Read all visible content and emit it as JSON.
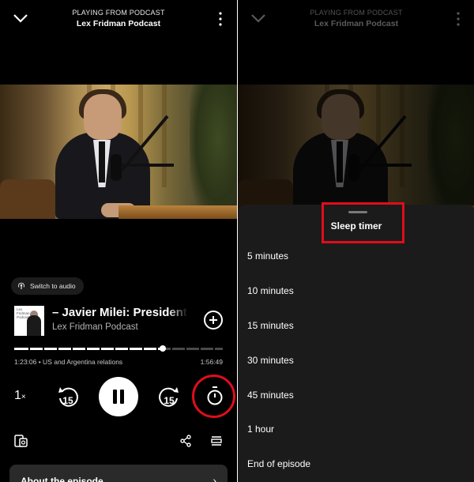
{
  "header": {
    "context": "PLAYING FROM PODCAST",
    "title": "Lex Fridman Podcast"
  },
  "player": {
    "switch_to_audio": "Switch to audio",
    "episode_title": "– Javier Milei: President",
    "show": "Lex Fridman Podcast",
    "thumb_text": "Lex\nFridman\nPodcast",
    "elapsed": "1:23:06",
    "chapter": "US and Argentina relations",
    "elapsed_label": "1:23:06 • US and Argentina relations",
    "duration": "1:56:49",
    "progress_fraction": 0.711,
    "speed_value": "1",
    "speed_suffix": "×",
    "skip_back": "15",
    "skip_forward": "15",
    "about": "About the episode"
  },
  "sleep_timer": {
    "title": "Sleep timer",
    "options": [
      "5 minutes",
      "10 minutes",
      "15 minutes",
      "30 minutes",
      "45 minutes",
      "1 hour",
      "End of episode"
    ]
  },
  "colors": {
    "background": "#000000",
    "sheet": "#1b1b1b",
    "highlight": "#e10d1b"
  }
}
